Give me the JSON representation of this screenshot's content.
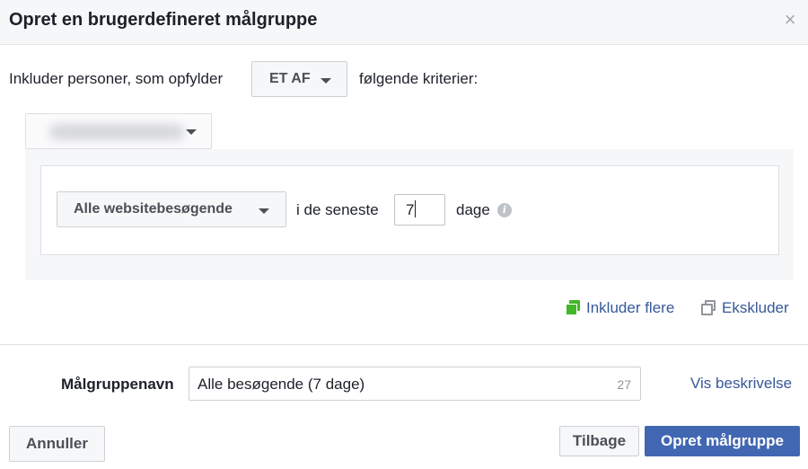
{
  "dialog": {
    "title": "Opret en brugerdefineret målgruppe",
    "close_glyph": "×"
  },
  "include_row": {
    "prefix": "Inkluder personer, som opfylder",
    "match_selector": "ET AF",
    "suffix": "følgende kriterier:"
  },
  "source_dropdown": {
    "value_blurred": true
  },
  "rule": {
    "audience_selector": "Alle websitebesøgende",
    "in_last_label": "i de seneste",
    "days_value": "7",
    "days_label": "dage",
    "info_glyph": "i"
  },
  "actions": {
    "include_more": "Inkluder flere",
    "exclude": "Ekskluder"
  },
  "audience_name": {
    "label": "Målgruppenavn",
    "value": "Alle besøgende (7 dage)",
    "char_count": "27",
    "show_description": "Vis beskrivelse"
  },
  "footer": {
    "cancel_label": "Annuller",
    "back_label": "Tilbage",
    "create_label": "Opret målgruppe"
  },
  "colors": {
    "accent": "#4267b2",
    "link": "#365899",
    "include_icon": "#42b72a"
  }
}
